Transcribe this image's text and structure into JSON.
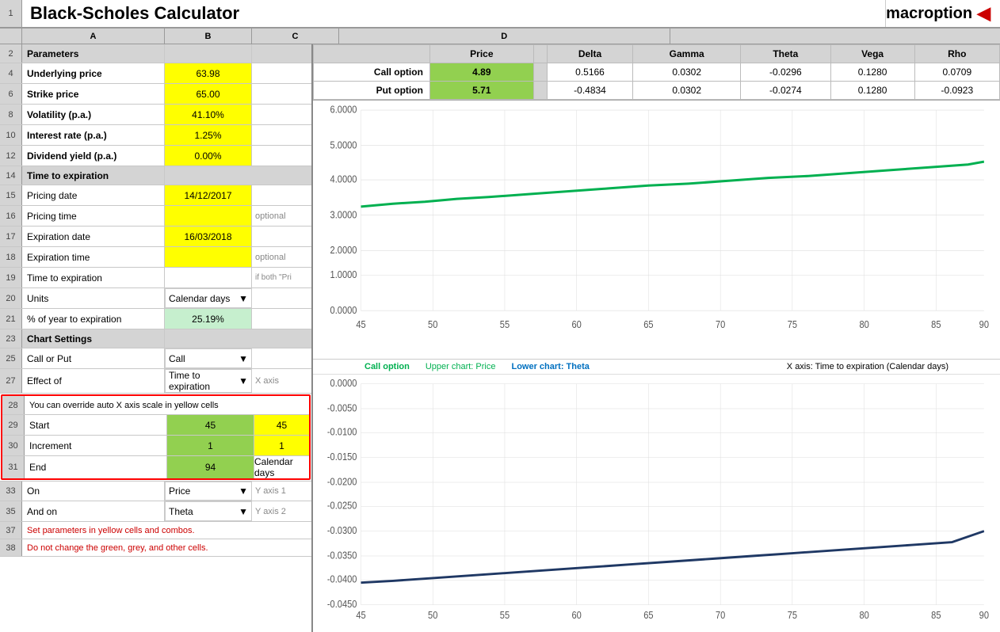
{
  "app": {
    "title": "Black-Scholes Calculator",
    "logo": "macroption",
    "row_num": "1"
  },
  "col_headers": [
    "",
    "A",
    "B",
    "C",
    "D"
  ],
  "params": {
    "section_row": "2",
    "section_label": "Parameters",
    "rows": [
      {
        "num": "4",
        "label": "Underlying price",
        "value": "63.98",
        "cell_class": "cell-yellow"
      },
      {
        "num": "6",
        "label": "Strike price",
        "value": "65.00",
        "cell_class": "cell-yellow"
      },
      {
        "num": "8",
        "label": "Volatility (p.a.)",
        "value": "41.10%",
        "cell_class": "cell-yellow"
      },
      {
        "num": "10",
        "label": "Interest rate (p.a.)",
        "value": "1.25%",
        "cell_class": "cell-yellow"
      },
      {
        "num": "12",
        "label": "Dividend yield (p.a.)",
        "value": "0.00%",
        "cell_class": "cell-yellow"
      }
    ],
    "time_section_row": "14",
    "time_section_label": "Time to expiration",
    "time_rows": [
      {
        "num": "15",
        "label": "Pricing date",
        "value": "14/12/2017",
        "cell_class": "cell-yellow",
        "extra": ""
      },
      {
        "num": "16",
        "label": "Pricing time",
        "value": "",
        "cell_class": "cell-yellow",
        "extra": "optional"
      },
      {
        "num": "17",
        "label": "Expiration date",
        "value": "16/03/2018",
        "cell_class": "cell-yellow",
        "extra": ""
      },
      {
        "num": "18",
        "label": "Expiration time",
        "value": "",
        "cell_class": "cell-yellow",
        "extra": "optional"
      },
      {
        "num": "19",
        "label": "Time to expiration",
        "value": "",
        "cell_class": "",
        "extra": "if both \"Pri"
      }
    ],
    "units_row": "20",
    "units_label": "Units",
    "units_value": "Calendar days",
    "pct_year_row": "21",
    "pct_year_label": "% of year to expiration",
    "pct_year_value": "25.19%"
  },
  "chart_settings": {
    "section_row": "23",
    "section_label": "Chart Settings",
    "call_put_row": "25",
    "call_put_label": "Call or Put",
    "call_put_value": "Call",
    "effect_row": "27",
    "effect_label": "Effect of",
    "effect_value": "Time to expiration",
    "effect_extra": "X axis",
    "note_row": "28",
    "note_text": "You can override auto X axis scale in yellow cells",
    "axis_rows": [
      {
        "num": "29",
        "label": "Start",
        "val_b": "45",
        "val_c": "45",
        "b_class": "cell-green",
        "c_class": "cell-yellow"
      },
      {
        "num": "30",
        "label": "Increment",
        "val_b": "1",
        "val_c": "1",
        "b_class": "cell-green",
        "c_class": "cell-yellow"
      },
      {
        "num": "31",
        "label": "End",
        "val_b": "94",
        "val_c": "Calendar days",
        "b_class": "cell-green",
        "c_class": ""
      }
    ],
    "on_row": "33",
    "on_label": "On",
    "on_value": "Price",
    "on_extra": "Y axis 1",
    "and_on_row": "35",
    "and_on_label": "And on",
    "and_on_value": "Theta",
    "and_on_extra": "Y axis 2",
    "set_params_row": "37",
    "set_params_text": "Set parameters in yellow cells and combos.",
    "no_change_row": "38",
    "no_change_text": "Do not change the green, grey, and other cells."
  },
  "results_table": {
    "headers": [
      "",
      "Price",
      "",
      "Delta",
      "Gamma",
      "Theta",
      "Vega",
      "Rho"
    ],
    "call_row": {
      "label": "Call option",
      "price": "4.89",
      "delta": "0.5166",
      "gamma": "0.0302",
      "theta": "-0.0296",
      "vega": "0.1280",
      "rho": "0.0709"
    },
    "put_row": {
      "label": "Put option",
      "price": "5.71",
      "delta": "-0.4834",
      "gamma": "0.0302",
      "theta": "-0.0274",
      "vega": "0.1280",
      "rho": "-0.0923"
    }
  },
  "chart_labels": {
    "call_option": "Call option",
    "upper_chart": "Upper chart: Price",
    "lower_chart": "Lower chart: Theta",
    "x_axis": "X axis: Time to expiration (Calendar days)"
  },
  "upper_chart": {
    "y_max": "6.0000",
    "y_vals": [
      "6.0000",
      "5.0000",
      "4.0000",
      "3.0000",
      "2.0000",
      "1.0000",
      "0.0000"
    ],
    "x_vals": [
      "45",
      "50",
      "55",
      "60",
      "65",
      "70",
      "75",
      "80",
      "85",
      "90"
    ],
    "curve_start_y": 3.1,
    "curve_end_y": 4.95,
    "y_min": 0,
    "y_range": 6
  },
  "lower_chart": {
    "y_vals": [
      "0.0000",
      "-0.0050",
      "-0.0100",
      "-0.0150",
      "-0.0200",
      "-0.0250",
      "-0.0300",
      "-0.0350",
      "-0.0400",
      "-0.0450"
    ],
    "x_vals": [
      "45",
      "50",
      "55",
      "60",
      "65",
      "70",
      "75",
      "80",
      "85",
      "90"
    ],
    "curve_start_y": -0.0405,
    "curve_end_y": -0.03
  }
}
